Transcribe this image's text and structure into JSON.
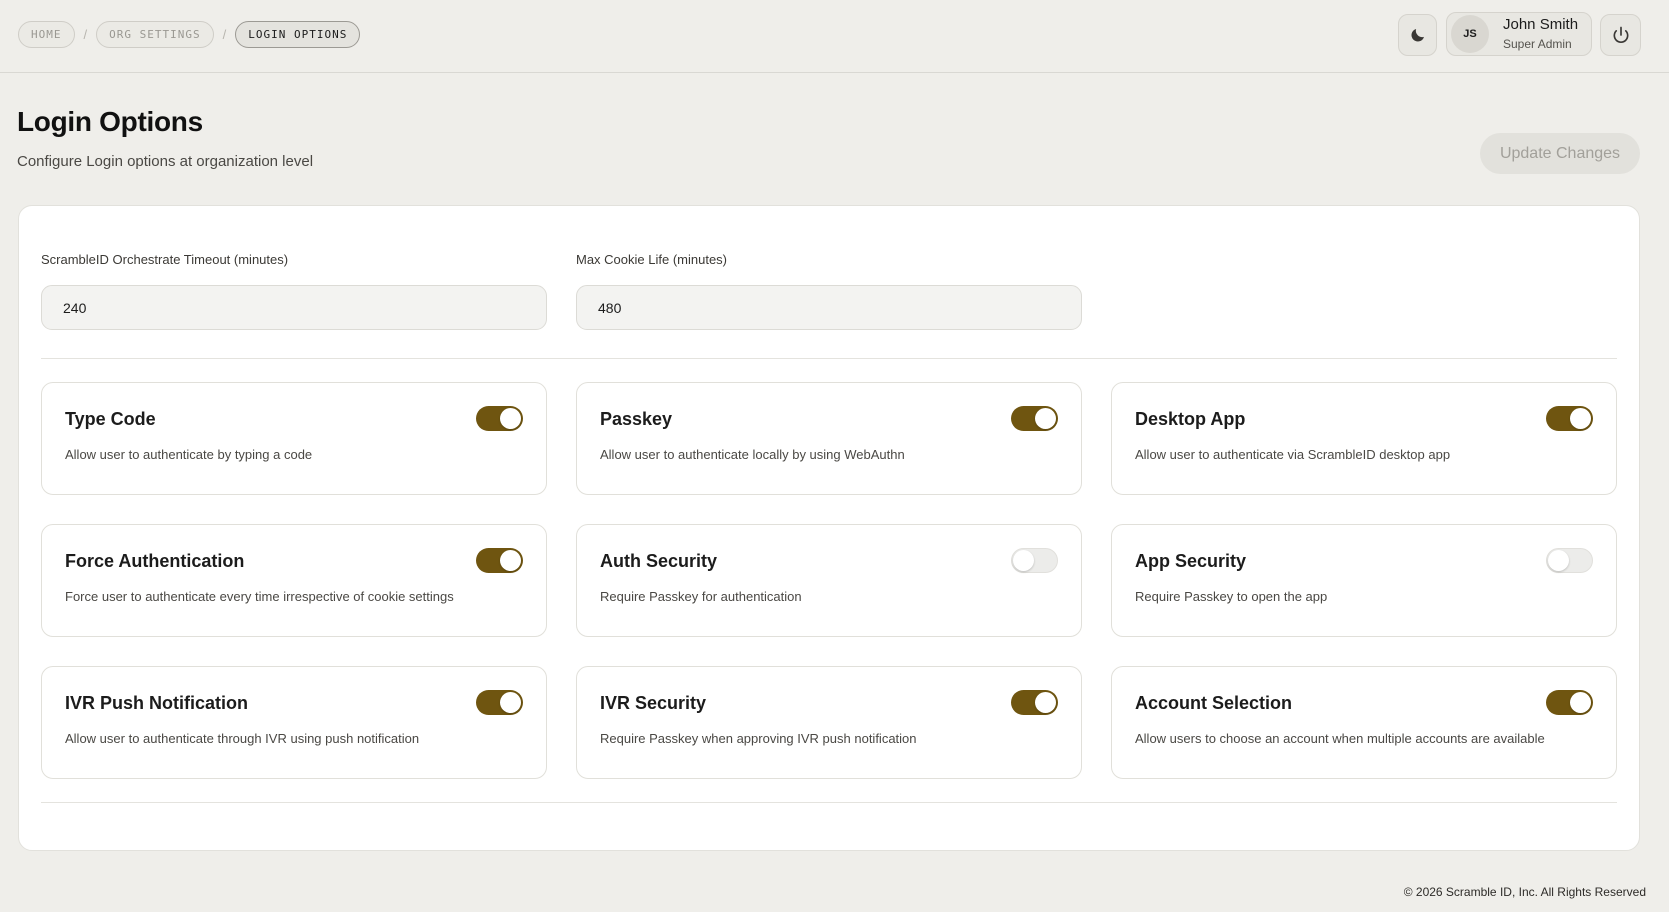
{
  "breadcrumb": [
    {
      "label": "HOME",
      "active": false
    },
    {
      "label": "ORG SETTINGS",
      "active": false
    },
    {
      "label": "LOGIN OPTIONS",
      "active": true
    }
  ],
  "breadcrumb_separator": "/",
  "header": {
    "theme_toggle_icon": "moon-icon",
    "user": {
      "initials": "JS",
      "name": "John Smith",
      "role": "Super Admin"
    },
    "logout_icon": "power-icon"
  },
  "page": {
    "title": "Login Options",
    "subtitle": "Configure Login options at organization level",
    "update_button": "Update Changes"
  },
  "fields": {
    "orchestrate_timeout": {
      "label": "ScrambleID Orchestrate Timeout (minutes)",
      "value": "240"
    },
    "max_cookie_life": {
      "label": "Max Cookie Life (minutes)",
      "value": "480"
    }
  },
  "options": [
    {
      "title": "Type Code",
      "description": "Allow user to authenticate by typing a code",
      "enabled": true
    },
    {
      "title": "Passkey",
      "description": "Allow user to authenticate locally by using WebAuthn",
      "enabled": true
    },
    {
      "title": "Desktop App",
      "description": "Allow user to authenticate via ScrambleID desktop app",
      "enabled": true
    },
    {
      "title": "Force Authentication",
      "description": "Force user to authenticate every time irrespective of cookie settings",
      "enabled": true
    },
    {
      "title": "Auth Security",
      "description": "Require Passkey for authentication",
      "enabled": false
    },
    {
      "title": "App Security",
      "description": "Require Passkey to open the app",
      "enabled": false
    },
    {
      "title": "IVR Push Notification",
      "description": "Allow user to authenticate through IVR using push notification",
      "enabled": true
    },
    {
      "title": "IVR Security",
      "description": "Require Passkey when approving IVR push notification",
      "enabled": true
    },
    {
      "title": "Account Selection",
      "description": "Allow users to choose an account when multiple accounts are available",
      "enabled": true
    }
  ],
  "colors": {
    "toggle_on": "#6f5510",
    "background": "#efeeea"
  },
  "footer": "© 2026 Scramble ID, Inc. All Rights Reserved"
}
